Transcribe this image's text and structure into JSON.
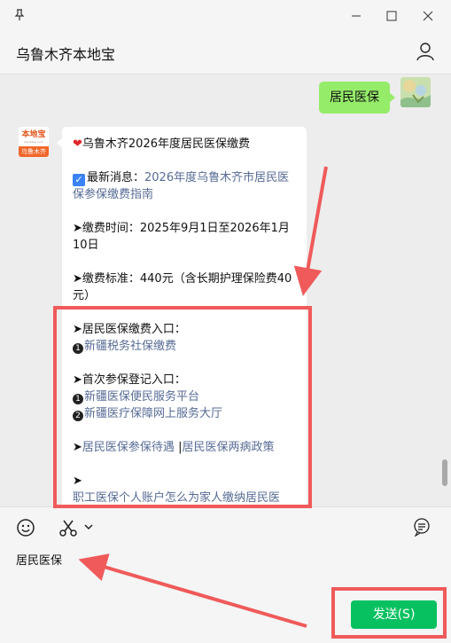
{
  "window": {
    "title": "乌鲁木齐本地宝"
  },
  "chat": {
    "my_message": "居民医保",
    "bot_avatar": {
      "logo": "本地宝",
      "sub": "bendibao.com",
      "city": "乌鲁木齐"
    },
    "bot_message": {
      "title": "乌鲁木齐2026年度居民医保缴费",
      "news_label": "最新消息：",
      "news_link": "2026年度乌鲁木齐市居民医保参保缴费指南",
      "time_label": "➤缴费时间：2025年9月1日至2026年1月10日",
      "standard_label": "➤缴费标准：440元（含长期护理保险费40元）",
      "pay_entry_label": "➤居民医保缴费入口：",
      "pay_entry_link": "新疆税务社保缴费",
      "register_label": "➤首次参保登记入口：",
      "register_link_1": "新疆医保便民服务平台",
      "register_link_2": "新疆医疗保障网上服务大厅",
      "benefit_link": "居民医保参保待遇",
      "separator": "|",
      "policy_link": "居民医保两病政策",
      "arrow_only": "➤",
      "cut_link": "职工医保个人账户怎么为家人缴纳居民医"
    }
  },
  "input": {
    "text": "居民医保",
    "send_label": "发送(S)"
  },
  "colors": {
    "send": "#07c160",
    "bubble_green": "#95ec69",
    "link": "#576b95",
    "annotation_red": "#f05a5a"
  },
  "icons": [
    "pin-icon",
    "minimize-icon",
    "maximize-icon",
    "close-icon",
    "user-icon",
    "emoji-icon",
    "scissors-icon",
    "chevron-down-icon",
    "chat-history-icon"
  ]
}
